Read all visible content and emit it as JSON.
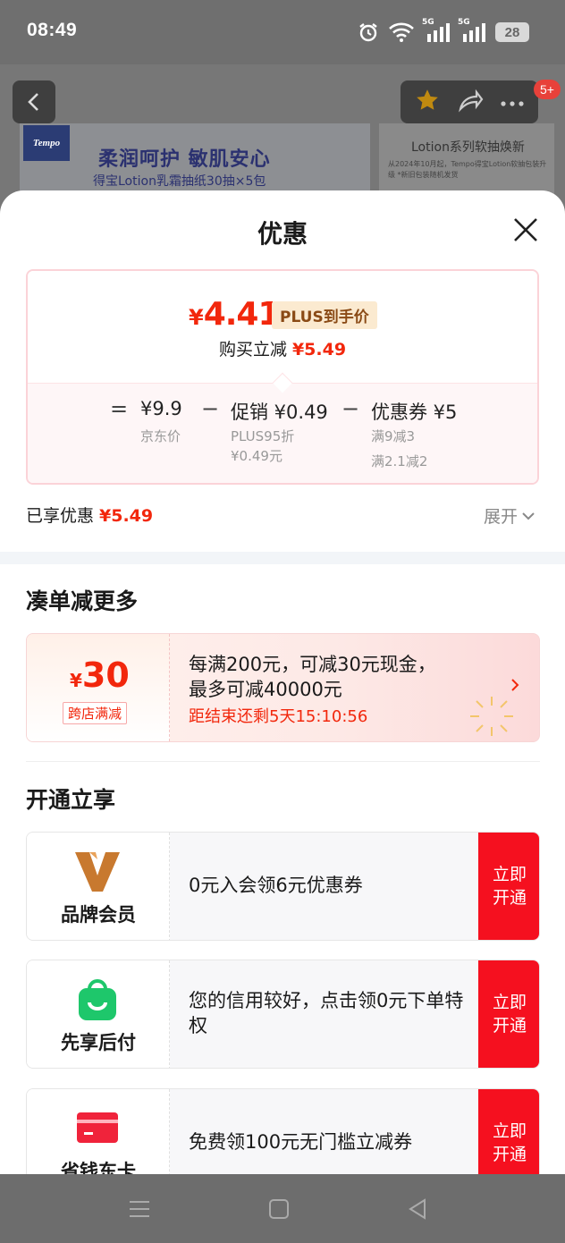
{
  "status_bar": {
    "time": "08:49",
    "signal_1_label": "5G",
    "signal_2_label": "5G",
    "battery": "28"
  },
  "background_page": {
    "badge_count": "5+",
    "banner": {
      "brand": "Tempo",
      "title": "柔润呵护 敏肌安心",
      "subtitle": "得宝Lotion乳霜抽纸30抽×5包"
    },
    "banner_right": {
      "title": "Lotion系列软抽焕新",
      "subtitle": "从2024年10月起，Tempo得宝Lotion软抽包装升级 *新旧包装随机发货"
    }
  },
  "sheet": {
    "title": "优惠",
    "price_card": {
      "currency": "¥",
      "final_price": "4.41",
      "plus_tag": "PLUS到手价",
      "reduce_label": "购买立减",
      "reduce_amount": "¥5.49",
      "calc": {
        "equals": "=",
        "base_price": "¥9.9",
        "base_label": "京东价",
        "minus_1": "−",
        "promo_price": "促销 ¥0.49",
        "promo_sub_1": "PLUS95折",
        "promo_sub_2": "¥0.49元",
        "minus_2": "−",
        "coupon_price": "优惠券 ¥5",
        "coupon_sub_1": "满9减3",
        "coupon_sub_2": "满2.1减2"
      }
    },
    "enjoyed_label": "已享优惠",
    "enjoyed_amount": "¥5.49",
    "expand_label": "展开",
    "section_more": {
      "title": "凑单减更多",
      "promo": {
        "currency": "¥",
        "amount": "30",
        "tag": "跨店满减",
        "line_1": "每满200元，可减30元现金，",
        "line_2": "最多可减40000元",
        "countdown": "距结束还剩5天15:10:56"
      }
    },
    "section_open": {
      "title": "开通立享",
      "cards": [
        {
          "label": "品牌会员",
          "text": "0元入会领6元优惠券",
          "button": "立即开通"
        },
        {
          "label": "先享后付",
          "text": "您的信用较好，点击领0元下单特权",
          "button": "立即开通"
        },
        {
          "label": "省钱东卡",
          "text": "免费领100元无门槛立减券",
          "button": "立即开通"
        }
      ]
    }
  },
  "colors": {
    "accent_red": "#f2270c",
    "button_red": "#f5101f",
    "plus_tag_bg": "#fbead0",
    "plus_tag_text": "#8a4a15",
    "brand_gold": "#c8792f",
    "pay_green": "#1ec76b"
  },
  "icons": [
    "alarm-icon",
    "wifi-icon",
    "signal-icon",
    "battery-icon",
    "back-icon",
    "star-icon",
    "share-icon",
    "more-icon",
    "close-icon",
    "chevron-down-icon",
    "chevron-right-icon",
    "brand-v-icon",
    "shopping-bag-icon",
    "card-icon",
    "menu-icon",
    "home-icon",
    "back-triangle-icon"
  ]
}
